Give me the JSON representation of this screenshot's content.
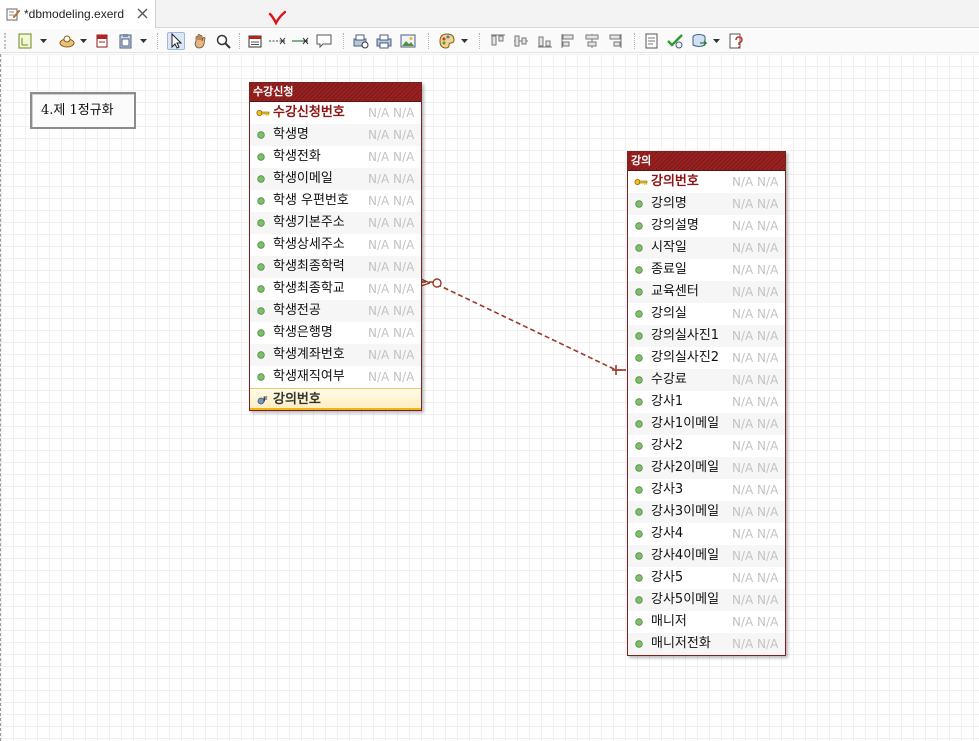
{
  "tab": {
    "label": "*dbmodeling.exerd",
    "icon": "erd-file-icon",
    "close_icon": "close-icon"
  },
  "toolbar": {
    "buttons": [
      {
        "name": "layer-icon",
        "has_dropdown": true
      },
      {
        "name": "palette-shape-icon",
        "has_dropdown": true
      },
      {
        "name": "color-box-icon",
        "has_dropdown": false
      },
      {
        "name": "clipboard-icon",
        "has_dropdown": true
      },
      {
        "name": "select-pointer-icon",
        "active": true
      },
      {
        "name": "hand-pan-icon"
      },
      {
        "name": "zoom-icon"
      },
      {
        "name": "new-entity-icon"
      },
      {
        "name": "non-identifying-relation-icon"
      },
      {
        "name": "identifying-relation-icon"
      },
      {
        "name": "memo-icon"
      },
      {
        "name": "print-preview-icon"
      },
      {
        "name": "print-icon"
      },
      {
        "name": "export-image-icon"
      },
      {
        "name": "color-palette-icon",
        "has_dropdown": true
      },
      {
        "name": "align-top-icon"
      },
      {
        "name": "align-middle-icon"
      },
      {
        "name": "align-bottom-icon"
      },
      {
        "name": "align-left-icon"
      },
      {
        "name": "align-center-icon"
      },
      {
        "name": "align-right-icon"
      },
      {
        "name": "report-icon"
      },
      {
        "name": "validate-icon"
      },
      {
        "name": "forward-engineer-icon",
        "has_dropdown": true
      },
      {
        "name": "properties-icon"
      }
    ],
    "annotation_mark": "v",
    "annotation_color": "#e01010"
  },
  "memo": {
    "text": "4.제 1정규화"
  },
  "entities": {
    "enrollment": {
      "title": "수강신청",
      "fields": [
        {
          "name": "수강신청번호",
          "type": "N/A N/A",
          "kind": "pk"
        },
        {
          "name": "학생명",
          "type": "N/A N/A",
          "kind": "attr"
        },
        {
          "name": "학생전화",
          "type": "N/A N/A",
          "kind": "attr"
        },
        {
          "name": "학생이메일",
          "type": "N/A N/A",
          "kind": "attr"
        },
        {
          "name": "학생 우편번호",
          "type": "N/A N/A",
          "kind": "attr"
        },
        {
          "name": "학생기본주소",
          "type": "N/A N/A",
          "kind": "attr"
        },
        {
          "name": "학생상세주소",
          "type": "N/A N/A",
          "kind": "attr"
        },
        {
          "name": "학생최종학력",
          "type": "N/A N/A",
          "kind": "attr"
        },
        {
          "name": "학생최종학교",
          "type": "N/A N/A",
          "kind": "attr"
        },
        {
          "name": "학생전공",
          "type": "N/A N/A",
          "kind": "attr"
        },
        {
          "name": "학생은행명",
          "type": "N/A N/A",
          "kind": "attr"
        },
        {
          "name": "학생계좌번호",
          "type": "N/A N/A",
          "kind": "attr"
        },
        {
          "name": "학생재직여부",
          "type": "N/A N/A",
          "kind": "attr"
        },
        {
          "name": "강의번호",
          "type": "",
          "kind": "fk"
        }
      ]
    },
    "lecture": {
      "title": "강의",
      "fields": [
        {
          "name": "강의번호",
          "type": "N/A N/A",
          "kind": "pk"
        },
        {
          "name": "강의명",
          "type": "N/A N/A",
          "kind": "attr"
        },
        {
          "name": "강의설명",
          "type": "N/A N/A",
          "kind": "attr"
        },
        {
          "name": "시작일",
          "type": "N/A N/A",
          "kind": "attr"
        },
        {
          "name": "종료일",
          "type": "N/A N/A",
          "kind": "attr"
        },
        {
          "name": "교육센터",
          "type": "N/A N/A",
          "kind": "attr"
        },
        {
          "name": "강의실",
          "type": "N/A N/A",
          "kind": "attr"
        },
        {
          "name": "강의실사진1",
          "type": "N/A N/A",
          "kind": "attr"
        },
        {
          "name": "강의실사진2",
          "type": "N/A N/A",
          "kind": "attr"
        },
        {
          "name": "수강료",
          "type": "N/A N/A",
          "kind": "attr"
        },
        {
          "name": "강사1",
          "type": "N/A N/A",
          "kind": "attr"
        },
        {
          "name": "강사1이메일",
          "type": "N/A N/A",
          "kind": "attr"
        },
        {
          "name": "강사2",
          "type": "N/A N/A",
          "kind": "attr"
        },
        {
          "name": "강사2이메일",
          "type": "N/A N/A",
          "kind": "attr"
        },
        {
          "name": "강사3",
          "type": "N/A N/A",
          "kind": "attr"
        },
        {
          "name": "강사3이메일",
          "type": "N/A N/A",
          "kind": "attr"
        },
        {
          "name": "강사4",
          "type": "N/A N/A",
          "kind": "attr"
        },
        {
          "name": "강사4이메일",
          "type": "N/A N/A",
          "kind": "attr"
        },
        {
          "name": "강사5",
          "type": "N/A N/A",
          "kind": "attr"
        },
        {
          "name": "강사5이메일",
          "type": "N/A N/A",
          "kind": "attr"
        },
        {
          "name": "매니저",
          "type": "N/A N/A",
          "kind": "attr"
        },
        {
          "name": "매니저전화",
          "type": "N/A N/A",
          "kind": "attr"
        }
      ]
    }
  },
  "relationship": {
    "from": "enrollment",
    "to": "lecture",
    "style": "dashed",
    "from_cardinality": "zero-or-many",
    "to_cardinality": "one",
    "color": "#9a3a2a"
  },
  "colors": {
    "entity_header": "#9b2121",
    "pk_text": "#8f1515",
    "fk_highlight": "#ffefbf",
    "type_text": "#c3c3c3"
  }
}
